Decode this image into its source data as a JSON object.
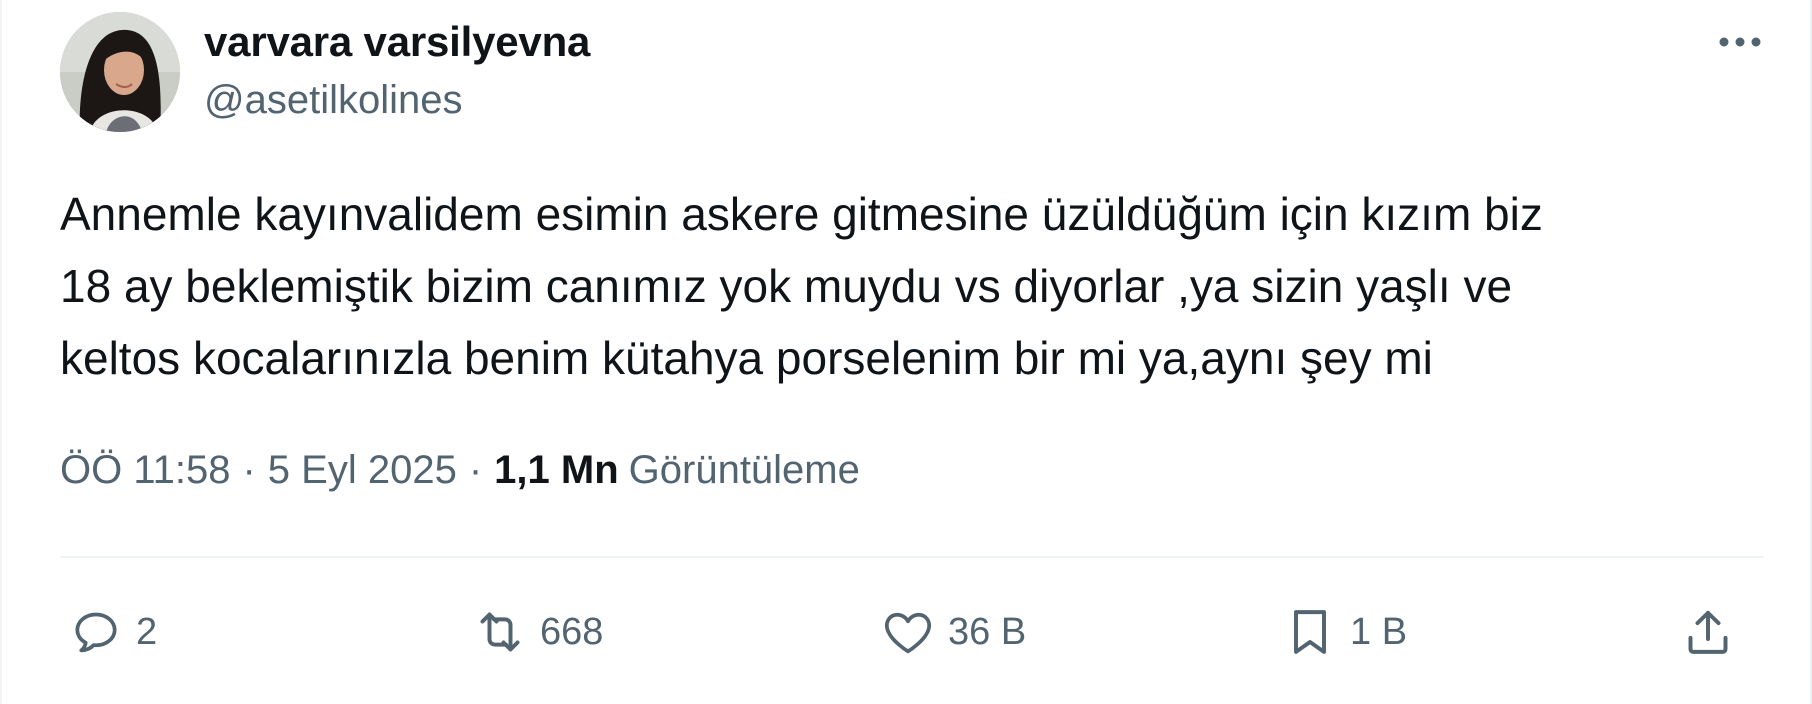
{
  "author": {
    "display_name": "varvara varsilyevna",
    "handle": "@asetilkolines",
    "avatar_icon": "profile-photo"
  },
  "tweet": {
    "text": "Annemle kayınvalidem esimin askere gitmesine üzüldüğüm için kızım biz\n18 ay beklemiştik bizim canımız yok muydu  vs diyorlar ,ya sizin yaşlı ve\nkeltos kocalarınızla benim kütahya porselenim bir mi ya,aynı şey mi"
  },
  "meta": {
    "time": "ÖÖ 11:58",
    "separator": "·",
    "date": "5 Eyl 2025",
    "views_count": "1,1 Mn",
    "views_label": "Görüntüleme"
  },
  "actions": {
    "reply": {
      "icon": "reply-icon",
      "count": "2"
    },
    "retweet": {
      "icon": "retweet-icon",
      "count": "668"
    },
    "like": {
      "icon": "heart-icon",
      "count": "36 B"
    },
    "bookmark": {
      "icon": "bookmark-icon",
      "count": "1 B"
    },
    "share": {
      "icon": "share-icon"
    }
  },
  "colors": {
    "text_primary": "#0f1419",
    "text_secondary": "#536471",
    "divider": "#eff3f4"
  }
}
